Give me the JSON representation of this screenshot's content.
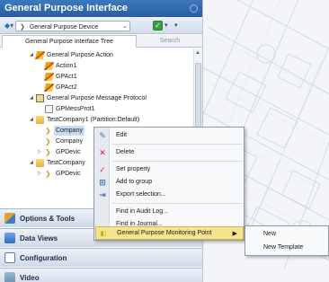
{
  "panel": {
    "title": "General Purpose Interface",
    "toolbar": {
      "selected_interface": "General Purpose Device"
    },
    "tabs": [
      "General Purpose Interface Tree",
      "Search"
    ]
  },
  "tree": [
    {
      "label": "General Purpose Action",
      "icon": "folder-action-icon",
      "expander": "▲"
    },
    {
      "label": "Action1",
      "icon": "action-icon"
    },
    {
      "label": "GPAct1",
      "icon": "action-icon"
    },
    {
      "label": "GPAct2",
      "icon": "action-icon"
    },
    {
      "label": "General Purpose Message Protocol",
      "icon": "protocol-folder-icon",
      "expander": "▲"
    },
    {
      "label": "GPMessProt1",
      "icon": "protocol-icon"
    },
    {
      "label": "TestCompany1 (Partition:Default)",
      "icon": "folder-icon",
      "expander": "▲"
    },
    {
      "label": "Company",
      "icon": "company-icon"
    },
    {
      "label": "Company",
      "icon": "company-icon"
    },
    {
      "label": "GPDevic",
      "icon": "company-icon",
      "expander": "▷"
    },
    {
      "label": "TestCompany",
      "icon": "folder-icon",
      "expander": "▲"
    },
    {
      "label": "GPDevic",
      "icon": "company-icon",
      "expander": "▷"
    }
  ],
  "nav": {
    "options": "Options & Tools",
    "data_views": "Data Views",
    "configuration": "Configuration",
    "video": "Video"
  },
  "context_menu": {
    "edit": "Edit",
    "delete": "Delete",
    "set_property": "Set property",
    "add_to_group": "Add to group",
    "export_selection": "Export selection...",
    "find_audit": "Find in Audit Log...",
    "find_journal": "Find in Journal...",
    "monitoring_point": "General Purpose Monitoring Point"
  },
  "submenu": {
    "new": "New",
    "new_template": "New Template"
  },
  "colors": {
    "header": "#2f69ad",
    "selected_menu": "#f6e38e",
    "tree_highlight": "#c7dbf4"
  }
}
